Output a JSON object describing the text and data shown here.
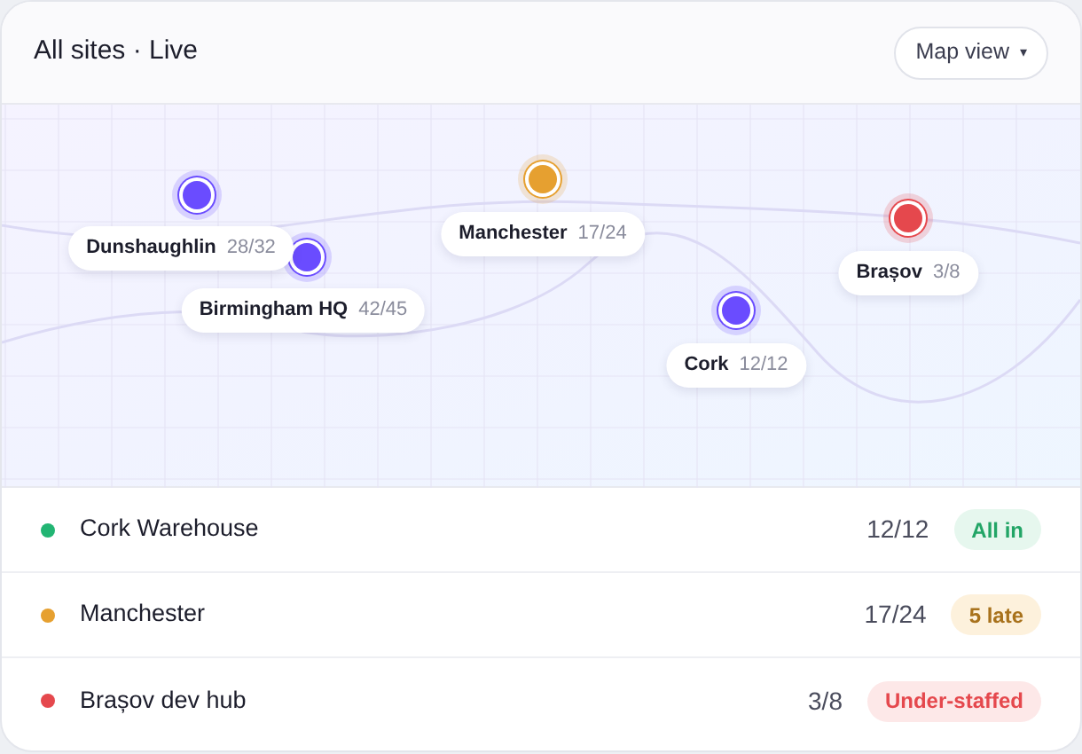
{
  "header": {
    "title": "All sites · Live",
    "view_button": "Map view",
    "caret": "▾"
  },
  "map": {
    "pins": [
      {
        "name": "Dunshaughlin",
        "count": "28/32",
        "color": "#6a4cff"
      },
      {
        "name": "Birmingham HQ",
        "count": "42/45",
        "color": "#6a4cff"
      },
      {
        "name": "Manchester",
        "count": "17/24",
        "color": "#e6a030"
      },
      {
        "name": "Cork",
        "count": "12/12",
        "color": "#6a4cff"
      },
      {
        "name": "Brașov",
        "count": "3/8",
        "color": "#e5484d"
      }
    ]
  },
  "sites": [
    {
      "name": "Cork Warehouse",
      "count": "12/12",
      "status": "All in",
      "kind": "ok",
      "color": "#22b573"
    },
    {
      "name": "Manchester",
      "count": "17/24",
      "status": "5 late",
      "kind": "warn",
      "color": "#e6a030"
    },
    {
      "name": "Brașov dev hub",
      "count": "3/8",
      "status": "Under-staffed",
      "kind": "bad",
      "color": "#e5484d"
    }
  ]
}
